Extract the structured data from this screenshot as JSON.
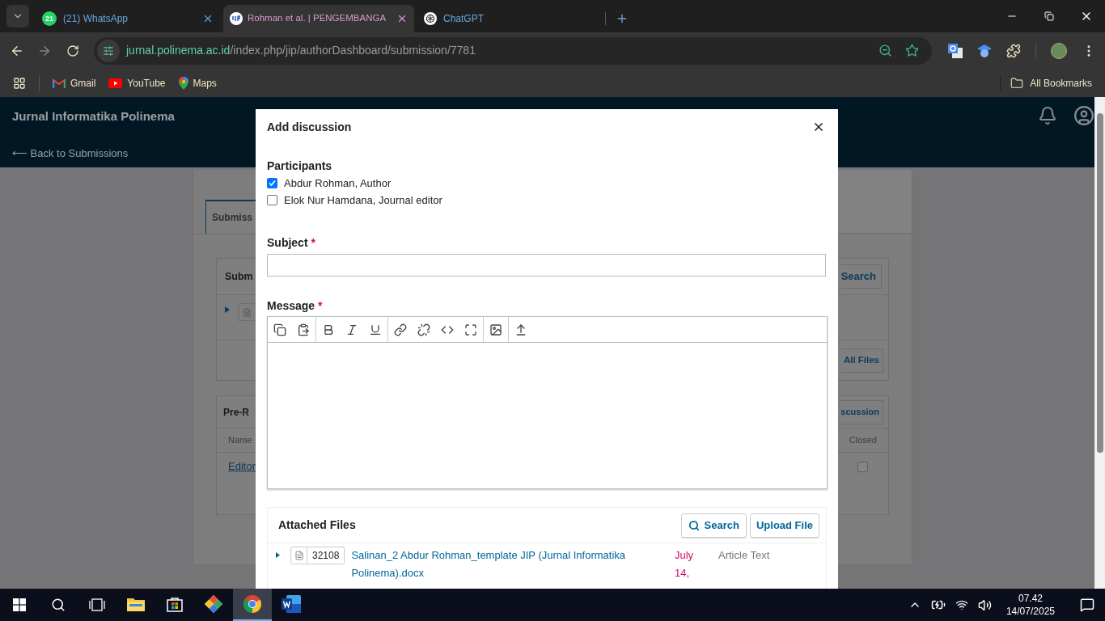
{
  "browser": {
    "tabs": [
      {
        "title": "(21) WhatsApp",
        "kind": "whatsapp",
        "favicon_text": "21",
        "selected": false
      },
      {
        "title": "Rohman et al. | PENGEMBANGA",
        "kind": "journal",
        "selected": true
      },
      {
        "title": "ChatGPT",
        "kind": "chat",
        "selected": false
      }
    ],
    "url": {
      "host": "jurnal.polinema.ac.id",
      "path": "/index.php/jip/authorDashboard/submission/7781"
    },
    "bookmarks": [
      {
        "label": "Gmail",
        "kind": "mail"
      },
      {
        "label": "YouTube",
        "kind": "video"
      },
      {
        "label": "Maps",
        "kind": "map"
      }
    ],
    "all_bookmarks": "All Bookmarks"
  },
  "header": {
    "journal_title": "Jurnal Informatika Polinema",
    "back_link": "⟵ Back to Submissions"
  },
  "background": {
    "tab": "Submiss",
    "files_panel": {
      "title": "Subm",
      "search_button": "Search",
      "all_files_button": "All Files"
    },
    "discussions_panel": {
      "title": "Pre-R",
      "add_button": "scussion",
      "columns": [
        "Name",
        "Closed"
      ],
      "rows": [
        {
          "name": "Editor",
          "closed": false
        }
      ]
    }
  },
  "modal": {
    "title": "Add discussion",
    "participants_label": "Participants",
    "participants": [
      {
        "name": "Abdur Rohman, Author",
        "checked": true
      },
      {
        "name": "Elok Nur Hamdana, Journal editor",
        "checked": false
      }
    ],
    "subject": {
      "label": "Subject",
      "required_mark": "*"
    },
    "message": {
      "label": "Message",
      "required_mark": "*"
    },
    "attached_files": {
      "title": "Attached Files",
      "search_button": "Search",
      "upload_button": "Upload File",
      "files": [
        {
          "id": "32108",
          "name": "Salinan_2 Abdur Rohman_template JIP (Jurnal Informatika Polinema).docx",
          "date": "July 14,",
          "type": "Article Text"
        }
      ]
    }
  },
  "taskbar": {
    "apps": [
      {
        "kind": "files",
        "selected": false
      },
      {
        "kind": "store",
        "selected": false
      },
      {
        "kind": "git",
        "selected": false
      },
      {
        "kind": "browser",
        "selected": true
      },
      {
        "kind": "word",
        "selected": false
      }
    ],
    "time": "07.42",
    "date": "14/07/2025"
  }
}
